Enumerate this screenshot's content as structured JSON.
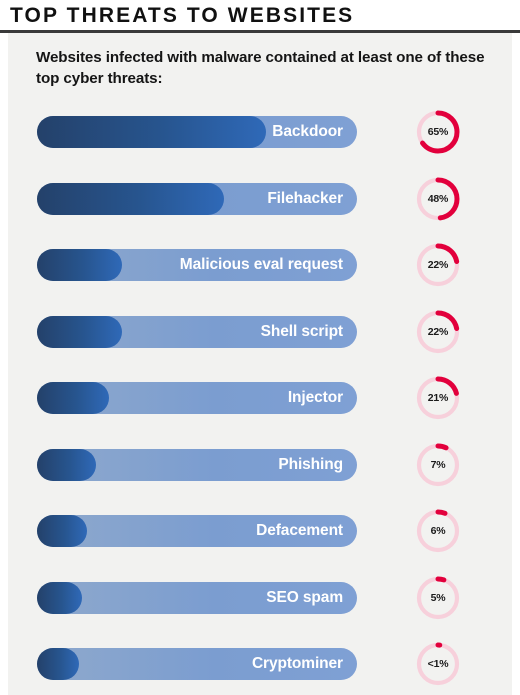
{
  "header": {
    "title": "TOP THREATS TO WEBSITES"
  },
  "panel": {
    "subtitle": "Websites infected with malware contained at least one of these top cyber threats:"
  },
  "colors": {
    "background": "#ffffff",
    "panel": "#f2f2f0",
    "rule": "#3a3a3a",
    "bar_fill_dark": "#24416a",
    "bar_fill_light": "#2f69b8",
    "bar_track_light": "#7b9dd0",
    "gauge_arc": "#e2003c",
    "gauge_track": "#f7d0db",
    "label_text": "#ffffff",
    "title_text": "#111111"
  },
  "chart_data": {
    "type": "bar",
    "title": "TOP THREATS TO WEBSITES",
    "subtitle": "Websites infected with malware contained at least one of these top cyber threats:",
    "xlabel": "",
    "ylabel": "",
    "ylim": [
      0,
      100
    ],
    "grid": false,
    "legend": "none",
    "value_suffix": "%",
    "categories": [
      "Backdoor",
      "Filehacker",
      "Malicious eval request",
      "Shell script",
      "Injector",
      "Phishing",
      "Defacement",
      "SEO spam",
      "Cryptominer"
    ],
    "values": [
      65,
      48,
      22,
      22,
      21,
      7,
      6,
      0.5
    ],
    "value_labels": [
      "65%",
      "48%",
      "22%",
      "22%",
      "21%",
      "7%",
      "6%",
      "5%",
      "<1%"
    ],
    "bar_fill_fraction": [
      0.715,
      0.585,
      0.265,
      0.265,
      0.225,
      0.185,
      0.155,
      0.14,
      0.13
    ]
  },
  "rows": [
    {
      "label": "Backdoor",
      "value_label": "65%",
      "percent": 65,
      "fill": 0.715
    },
    {
      "label": "Filehacker",
      "value_label": "48%",
      "percent": 48,
      "fill": 0.585
    },
    {
      "label": "Malicious eval request",
      "value_label": "22%",
      "percent": 22,
      "fill": 0.265
    },
    {
      "label": "Shell script",
      "value_label": "22%",
      "percent": 22,
      "fill": 0.265
    },
    {
      "label": "Injector",
      "value_label": "21%",
      "percent": 21,
      "fill": 0.225
    },
    {
      "label": "Phishing",
      "value_label": "7%",
      "percent": 7,
      "fill": 0.185
    },
    {
      "label": "Defacement",
      "value_label": "6%",
      "percent": 6,
      "fill": 0.155
    },
    {
      "label": "SEO spam",
      "value_label": "5%",
      "percent": 5,
      "fill": 0.14
    },
    {
      "label": "Cryptominer",
      "value_label": "<1%",
      "percent": 1,
      "fill": 0.13
    }
  ]
}
